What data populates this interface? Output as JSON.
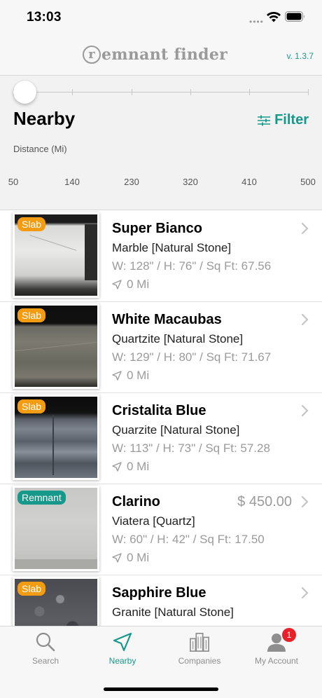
{
  "status_bar": {
    "time": "13:03",
    "icons": [
      "signal-dots-icon",
      "wifi-icon",
      "battery-icon"
    ]
  },
  "header": {
    "logo_mark": "r",
    "logo_text": "emnant finder",
    "version": "v. 1.3.7"
  },
  "nearby": {
    "title": "Nearby",
    "filter_label": "Filter",
    "filter_icon": "filter-sliders-icon",
    "distance_label": "Distance (Mi)",
    "slider": {
      "min": 50,
      "max": 500,
      "value": 50,
      "tick_labels": [
        "50",
        "140",
        "230",
        "320",
        "410",
        "500"
      ]
    }
  },
  "items": [
    {
      "badge": "Slab",
      "badge_type": "slab",
      "name": "Super Bianco",
      "price": "",
      "material": "Marble [Natural Stone]",
      "dimensions": "W: 128\" / H: 76\" / Sq Ft: 67.56",
      "distance": "0 Mi",
      "image": "white-marble-slab-photo"
    },
    {
      "badge": "Slab",
      "badge_type": "slab",
      "name": "White Macaubas",
      "price": "",
      "material": "Quartzite [Natural Stone]",
      "dimensions": "W: 129\" / H: 80\" / Sq Ft: 71.67",
      "distance": "0 Mi",
      "image": "grey-quartzite-slab-photo"
    },
    {
      "badge": "Slab",
      "badge_type": "slab",
      "name": "Cristalita Blue",
      "price": "",
      "material": "Quarzite [Natural Stone]",
      "dimensions": "W: 113\" / H: 73\" / Sq Ft: 57.28",
      "distance": "0 Mi",
      "image": "blue-veined-slab-photo"
    },
    {
      "badge": "Remnant",
      "badge_type": "remnant",
      "name": "Clarino",
      "price": "$ 450.00",
      "material": "Viatera [Quartz]",
      "dimensions": "W: 60\" / H: 42\" / Sq Ft: 17.50",
      "distance": "0 Mi",
      "image": "light-grey-quartz-photo"
    },
    {
      "badge": "Slab",
      "badge_type": "slab",
      "name": "Sapphire Blue",
      "price": "",
      "material": "Granite [Natural Stone]",
      "dimensions": "",
      "distance": "",
      "image": "dark-granite-slab-photo"
    }
  ],
  "tabs": [
    {
      "label": "Search",
      "icon": "magnifier-icon",
      "active": false
    },
    {
      "label": "Nearby",
      "icon": "location-arrow-icon",
      "active": true
    },
    {
      "label": "Companies",
      "icon": "buildings-icon",
      "active": false
    },
    {
      "label": "My Account",
      "icon": "person-icon",
      "active": false,
      "badge": "1"
    }
  ],
  "colors": {
    "accent": "#16998a",
    "slab_badge": "#f39c12",
    "notification": "#e8202a"
  }
}
